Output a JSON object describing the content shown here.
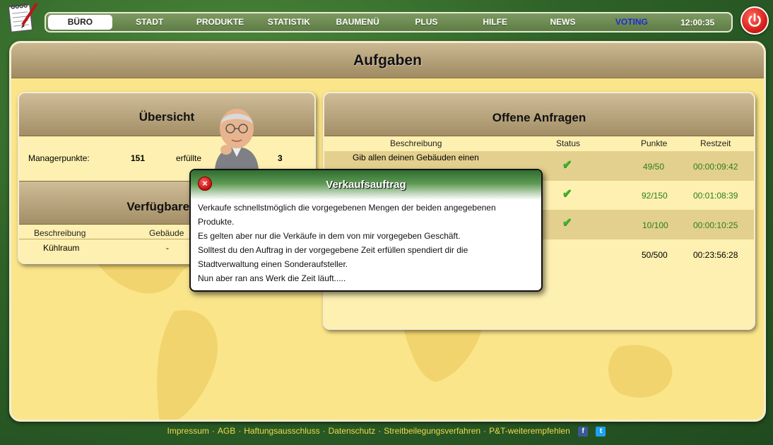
{
  "nav": {
    "items": [
      {
        "label": "BÜRO",
        "active": true
      },
      {
        "label": "STADT"
      },
      {
        "label": "PRODUKTE"
      },
      {
        "label": "STATISTIK"
      },
      {
        "label": "BAUMENÜ"
      },
      {
        "label": "PLUS"
      },
      {
        "label": "HILFE"
      },
      {
        "label": "NEWS"
      },
      {
        "label": "VOTING"
      }
    ],
    "clock": "12:00:35"
  },
  "main": {
    "title": "Aufgaben"
  },
  "overview": {
    "title": "Übersicht",
    "manager_label": "Managerpunkte:",
    "manager_value": "151",
    "fulfilled_label": "erfüllte",
    "fulfilled_value": "3"
  },
  "available": {
    "title": "Verfügbare Fe",
    "headers": [
      "Beschreibung",
      "Gebäude"
    ],
    "rows": [
      {
        "desc": "Kühlraum",
        "building": "-"
      }
    ]
  },
  "requests": {
    "title": "Offene Anfragen",
    "headers": [
      "Beschreibung",
      "Status",
      "Punkte",
      "Restzeit"
    ],
    "rows": [
      {
        "desc": "Gib allen deinen Gebäuden einen",
        "status": "check",
        "points": "49/50",
        "time": "00:00:09:42"
      },
      {
        "desc": "",
        "status": "check",
        "points": "92/150",
        "time": "00:01:08:39"
      },
      {
        "desc": "",
        "status": "check",
        "points": "10/100",
        "time": "00:00:10:25"
      },
      {
        "desc": "",
        "status": "",
        "points": "50/500",
        "time": "00:23:56:28"
      }
    ]
  },
  "popup": {
    "title": "Verkaufsauftrag",
    "close": "×",
    "lines": [
      "Verkaufe schnellstmöglich die vorgegebenen Mengen der beiden angegebenen",
      "Produkte.",
      "Es gelten aber nur die Verkäufe in dem von mir vorgegeben Geschäft.",
      "Solltest du den Auftrag in der vorgegebene Zeit erfüllen spendiert dir die",
      "Stadtverwaltung einen Sonderaufsteller.",
      "Nun aber ran ans Werk die Zeit läuft....."
    ]
  },
  "footer": {
    "links": [
      "Impressum",
      "AGB",
      "Haftungsausschluss",
      "Datenschutz",
      "Streitbeilegungsverfahren",
      "P&T-weiterempfehlen"
    ],
    "separator": "·",
    "facebook": "f",
    "twitter": "t"
  },
  "icons": {
    "notepad": "notepad-pencil-icon",
    "power": "power-icon",
    "check": "checkmark-icon",
    "close": "close-icon"
  },
  "colors": {
    "accent_green": "#2d7d1d",
    "panel_bg": "#fbe58a",
    "nav_voting": "#1b2ad8",
    "power_red": "#d8211a"
  }
}
